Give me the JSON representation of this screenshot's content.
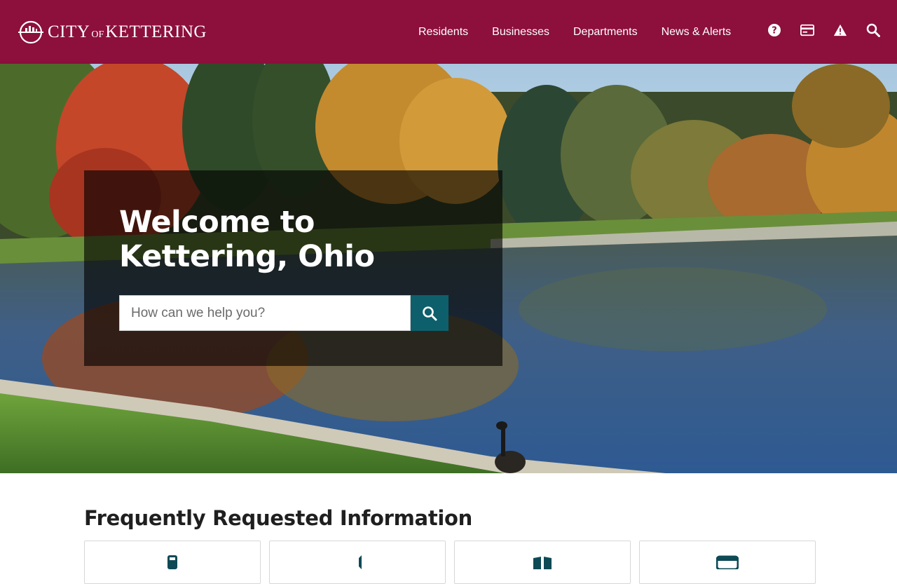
{
  "header": {
    "logo_text_city": "City",
    "logo_text_of": "of",
    "logo_text_kettering": "Kettering",
    "nav": [
      {
        "label": "Residents"
      },
      {
        "label": "Businesses"
      },
      {
        "label": "Departments"
      },
      {
        "label": "News & Alerts"
      }
    ],
    "util_icons": [
      "help-icon",
      "payment-card-icon",
      "alert-icon",
      "search-icon"
    ],
    "background_color": "#8c0f3c"
  },
  "hero": {
    "title": "Welcome to Kettering, Ohio",
    "search": {
      "placeholder": "How can we help you?",
      "value": ""
    },
    "search_button_color": "#0d5f6b"
  },
  "frequently_requested": {
    "title": "Frequently Requested Information",
    "cards": [
      {
        "icon": "phone-icon"
      },
      {
        "icon": "megaphone-icon"
      },
      {
        "icon": "book-icon"
      },
      {
        "icon": "calendar-icon"
      }
    ]
  }
}
